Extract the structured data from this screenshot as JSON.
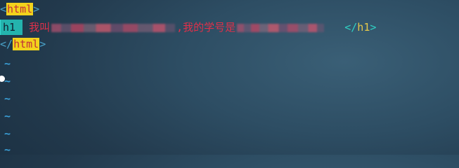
{
  "editor": {
    "line1": {
      "open_bracket": "<",
      "tag": "html",
      "close_bracket": ">"
    },
    "line2": {
      "tag": "h1",
      "text_before": " 我叫",
      "text_middle": ",我的学号是",
      "closing_open": "</",
      "closing_tag": "h1",
      "closing_close": ">"
    },
    "line3": {
      "open_bracket": "</",
      "tag": "html",
      "close_bracket": ">"
    },
    "empty_line_marker": "~"
  }
}
